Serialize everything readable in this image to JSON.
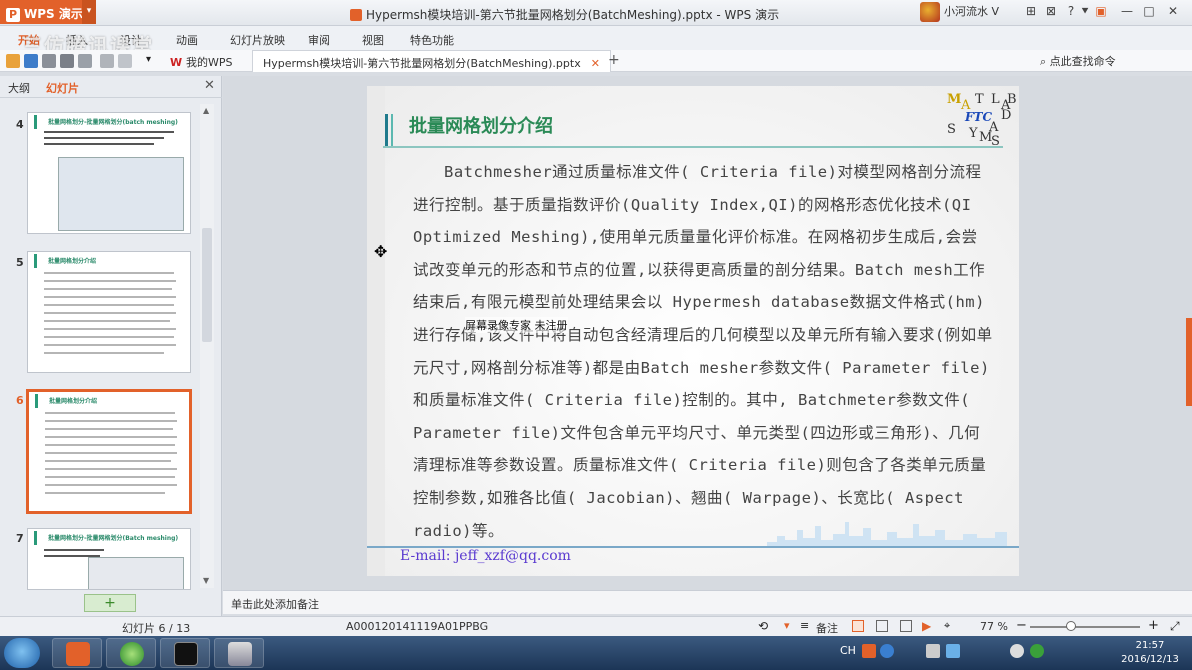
{
  "app": {
    "name": "WPS 演示",
    "window_title": "Hypermsh模块培训-第六节批量网格划分(BatchMeshing).pptx - WPS 演示",
    "user_name": "小河流水 V",
    "title_buttons": [
      "⊞",
      "⊠",
      "?",
      "⯆",
      "▣",
      "—",
      "□",
      "✕"
    ]
  },
  "ribbon": {
    "tabs": [
      "开始",
      "插入",
      "设计",
      "动画",
      "幻灯片放映",
      "审阅",
      "视图",
      "特色功能"
    ],
    "overlay_watermark": "三仿腾讯课堂"
  },
  "doc_tabs": {
    "my_wps": "我的WPS",
    "active": "Hypermsh模块培训-第六节批量网格划分(BatchMeshing).pptx",
    "right_tool": "点此查找命令"
  },
  "left_panel": {
    "tab_outline": "大纲",
    "tab_slides": "幻灯片",
    "close": "✕",
    "thumbs": [
      {
        "num": "4",
        "title": "批量网格划分-批量网格划分(batch meshing)"
      },
      {
        "num": "5",
        "title": "批量网格划分介绍"
      },
      {
        "num": "6",
        "title": "批量网格划分介绍",
        "selected": true
      },
      {
        "num": "7",
        "title": "批量网格划分-批量网格划分(Batch meshing)"
      }
    ],
    "add": "+"
  },
  "slide": {
    "title": "批量网格划分介绍",
    "body": "Batchmesher通过质量标准文件( Criteria file)对模型网格剖分流程进行控制。基于质量指数评价(Quality Index,QI)的网格形态优化技术(QI Optimized Meshing),使用单元质量量化评价标准。在网格初步生成后,会尝试改变单元的形态和节点的位置,以获得更高质量的剖分结果。Batch mesh工作结束后,有限元模型前处理结果会以 Hypermesh database数据文件格式(hm)进行存储,该文件中将自动包含经清理后的几何模型以及单元所有输入要求(例如单元尺寸,网格剖分标准等)都是由Batch mesher参数文件( Parameter file)和质量标准文件( Criteria file)控制的。其中, Batchmeter参数文件( Parameter file)文件包含单元平均尺寸、单元类型(四边形或三角形)、几何清理标准等参数设置。质量标准文件( Criteria file)则包含了各类单元质量控制参数,如雅各比值( Jacobian)、翘曲( Warpage)、长宽比( Aspect radio)等。",
    "email": "E-mail: jeff_xzf@qq.com",
    "logo_letters": [
      "M",
      "A",
      "T",
      "L",
      "A",
      "B",
      "D",
      "S",
      "Y",
      "A",
      "M",
      "S"
    ],
    "logo_mark": "FTC",
    "recorder_stamp": "屏幕录像专家 未注册"
  },
  "notes": {
    "placeholder": "单击此处添加备注"
  },
  "status": {
    "slide_counter": "幻灯片 6 / 13",
    "doc_id": "A000120141119A01PPBG",
    "notes_label": "备注",
    "zoom": "77 %"
  },
  "taskbar": {
    "tray_text": "CH",
    "time": "21:57",
    "date": "2016/12/13"
  },
  "colors": {
    "accent": "#e2612a",
    "slide_title": "#2a8a56",
    "email": "#5a3ad0"
  }
}
